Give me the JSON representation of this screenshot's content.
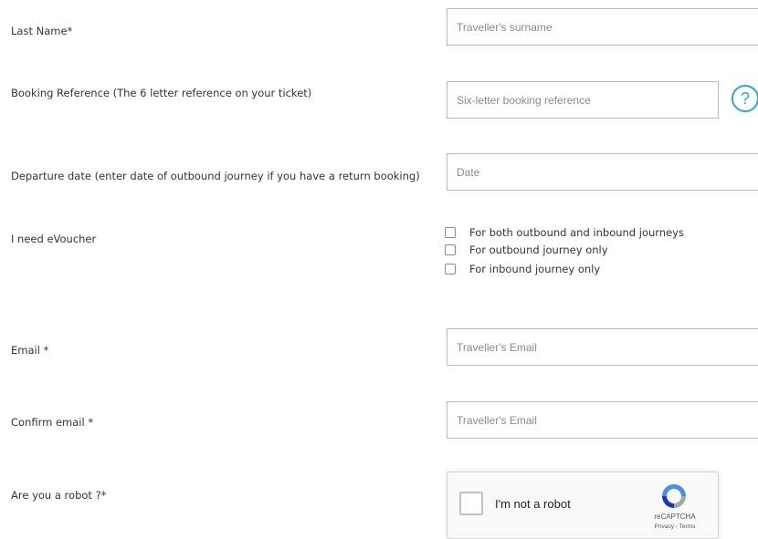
{
  "form": {
    "last_name": {
      "label": "Last Name*",
      "placeholder": "Traveller's surname"
    },
    "booking_reference": {
      "label": "Booking Reference (The 6 letter reference on your ticket)",
      "placeholder": "Six-letter booking reference",
      "help_icon": "question-circle-icon",
      "help_glyph": "?"
    },
    "departure_date": {
      "label": "Departure date (enter date of outbound journey if you have a return booking)",
      "placeholder": "Date"
    },
    "evoucher": {
      "label": "I need eVoucher",
      "options": [
        "For both outbound and inbound journeys",
        "For outbound journey only",
        "For inbound journey only"
      ]
    },
    "email": {
      "label": "Email *",
      "placeholder": "Traveller's Email"
    },
    "confirm_email": {
      "label": "Confirm email *",
      "placeholder": "Traveller's Email"
    },
    "robot": {
      "label": "Are you a robot ?*",
      "captcha_text": "I'm not a robot",
      "captcha_brand": "reCAPTCHA",
      "captcha_links": "Privacy - Terms",
      "captcha_icon": "recaptcha-logo-icon"
    }
  },
  "colors": {
    "accent": "#2aa6c8",
    "input_border": "#b9b9b9",
    "text": "#333333",
    "placeholder": "#8a8a8a"
  }
}
